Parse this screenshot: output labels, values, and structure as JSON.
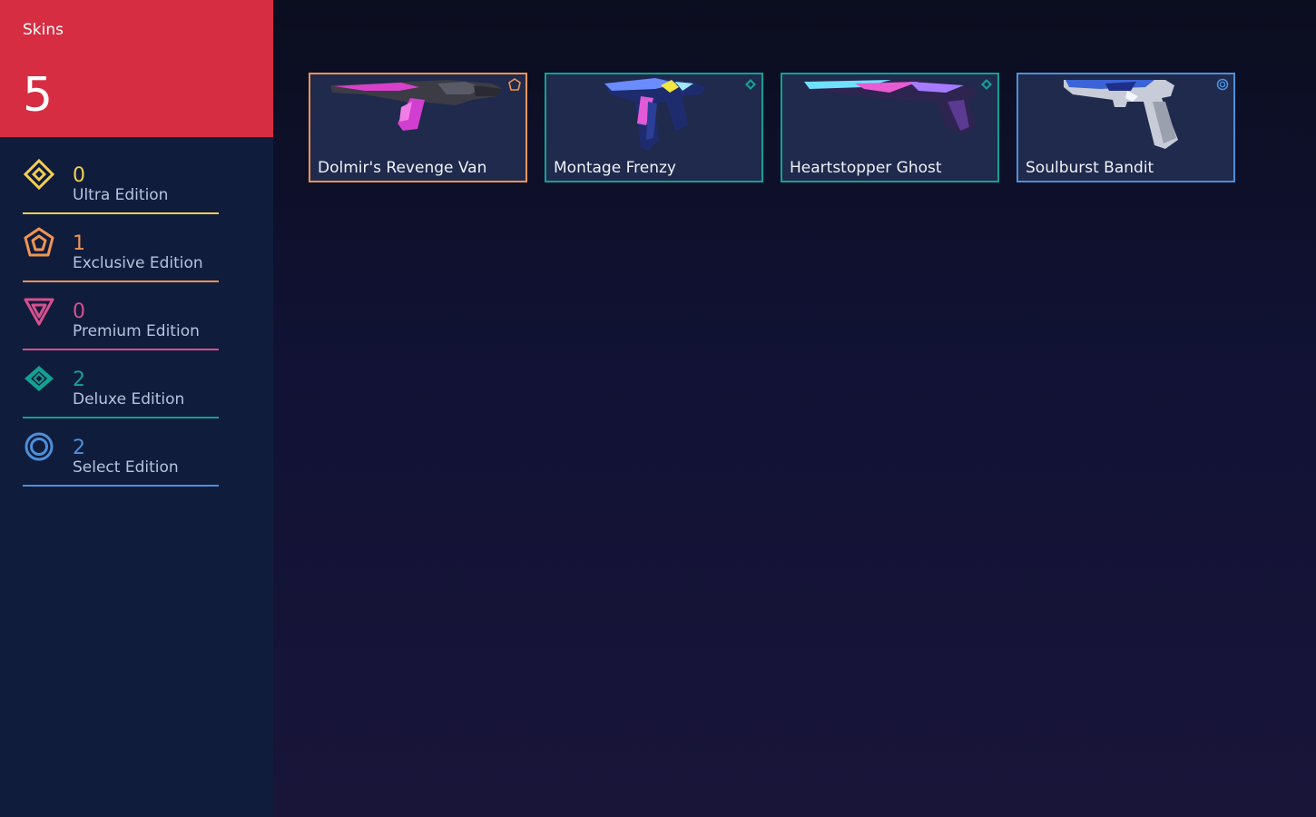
{
  "colors": {
    "ultra": "#f3cf51",
    "exclusive": "#ee9554",
    "premium": "#d6518e",
    "deluxe": "#14a092",
    "select": "#4d8fd9",
    "total_panel": "#d62d42",
    "sidebar": "#101c3c",
    "card_bg": "#1f2a4c"
  },
  "summary": {
    "label": "Skins",
    "total": "5"
  },
  "tiers": [
    {
      "icon": "ultra-edition-icon",
      "count": "0",
      "label": "Ultra Edition"
    },
    {
      "icon": "exclusive-edition-icon",
      "count": "1",
      "label": "Exclusive Edition"
    },
    {
      "icon": "premium-edition-icon",
      "count": "0",
      "label": "Premium Edition"
    },
    {
      "icon": "deluxe-edition-icon",
      "count": "2",
      "label": "Deluxe Edition"
    },
    {
      "icon": "select-edition-icon",
      "count": "2",
      "label": "Select Edition"
    }
  ],
  "skins": [
    {
      "name": "Dolmir's Revenge Van",
      "tier": "exclusive",
      "icon": "rifle-skin-image"
    },
    {
      "name": "Montage Frenzy",
      "tier": "deluxe",
      "icon": "pistol-skin-image"
    },
    {
      "name": "Heartstopper Ghost",
      "tier": "deluxe",
      "icon": "pistol-skin-image"
    },
    {
      "name": "Soulburst Bandit",
      "tier": "select",
      "icon": "pistol-skin-image"
    }
  ]
}
